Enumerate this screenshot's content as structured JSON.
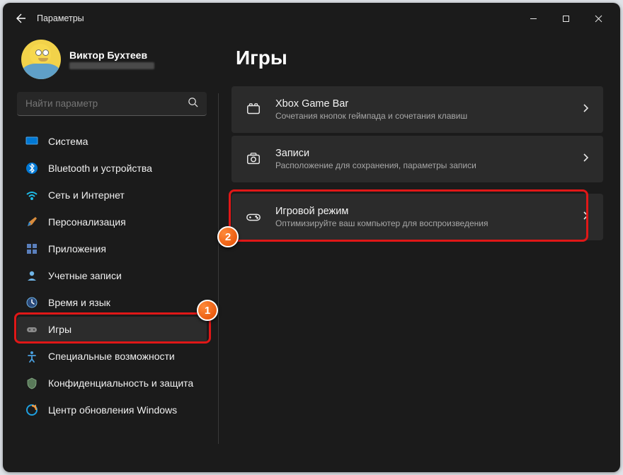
{
  "app": {
    "title": "Параметры"
  },
  "user": {
    "name": "Виктор Бухтеев"
  },
  "search": {
    "placeholder": "Найти параметр"
  },
  "sidebar": {
    "items": [
      {
        "id": "system",
        "label": "Система"
      },
      {
        "id": "bluetooth",
        "label": "Bluetooth и устройства"
      },
      {
        "id": "network",
        "label": "Сеть и Интернет"
      },
      {
        "id": "personalization",
        "label": "Персонализация"
      },
      {
        "id": "apps",
        "label": "Приложения"
      },
      {
        "id": "accounts",
        "label": "Учетные записи"
      },
      {
        "id": "time",
        "label": "Время и язык"
      },
      {
        "id": "gaming",
        "label": "Игры",
        "selected": true
      },
      {
        "id": "accessibility",
        "label": "Специальные возможности"
      },
      {
        "id": "privacy",
        "label": "Конфиденциальность и защита"
      },
      {
        "id": "update",
        "label": "Центр обновления Windows"
      }
    ]
  },
  "page": {
    "title": "Игры"
  },
  "cards": [
    {
      "id": "xbox-bar",
      "title": "Xbox Game Bar",
      "desc": "Сочетания кнопок геймпада и сочетания клавиш"
    },
    {
      "id": "captures",
      "title": "Записи",
      "desc": "Расположение для сохранения, параметры записи"
    },
    {
      "id": "game-mode",
      "title": "Игровой режим",
      "desc": "Оптимизируйте ваш компьютер для воспроизведения"
    }
  ],
  "annotations": {
    "badge1": "1",
    "badge2": "2"
  }
}
